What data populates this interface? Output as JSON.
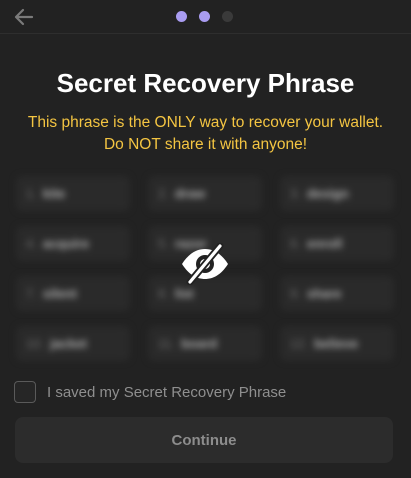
{
  "header": {
    "back_icon": "arrow-left-icon",
    "steps": [
      {
        "state": "complete",
        "color": "#a99cf1"
      },
      {
        "state": "active",
        "color": "#a99cf1"
      },
      {
        "state": "pending",
        "color": "#3a3a3a"
      }
    ]
  },
  "title": "Secret Recovery Phrase",
  "warning": {
    "text": "This phrase is the ONLY way to recover your wallet. Do NOT share it with anyone!",
    "color": "#f4c542"
  },
  "phrase": {
    "hidden": true,
    "toggle_icon": "eye-off-icon",
    "words": [
      {
        "num": "1.",
        "word": "kite"
      },
      {
        "num": "2.",
        "word": "draw"
      },
      {
        "num": "3.",
        "word": "design"
      },
      {
        "num": "4.",
        "word": "acquire"
      },
      {
        "num": "5.",
        "word": "razor"
      },
      {
        "num": "6.",
        "word": "enroll"
      },
      {
        "num": "7.",
        "word": "silent"
      },
      {
        "num": "8.",
        "word": "list"
      },
      {
        "num": "9.",
        "word": "share"
      },
      {
        "num": "10.",
        "word": "jacket"
      },
      {
        "num": "11.",
        "word": "board"
      },
      {
        "num": "12.",
        "word": "believe"
      }
    ]
  },
  "confirm": {
    "checked": false,
    "label": "I saved my Secret Recovery Phrase"
  },
  "continue_label": "Continue"
}
